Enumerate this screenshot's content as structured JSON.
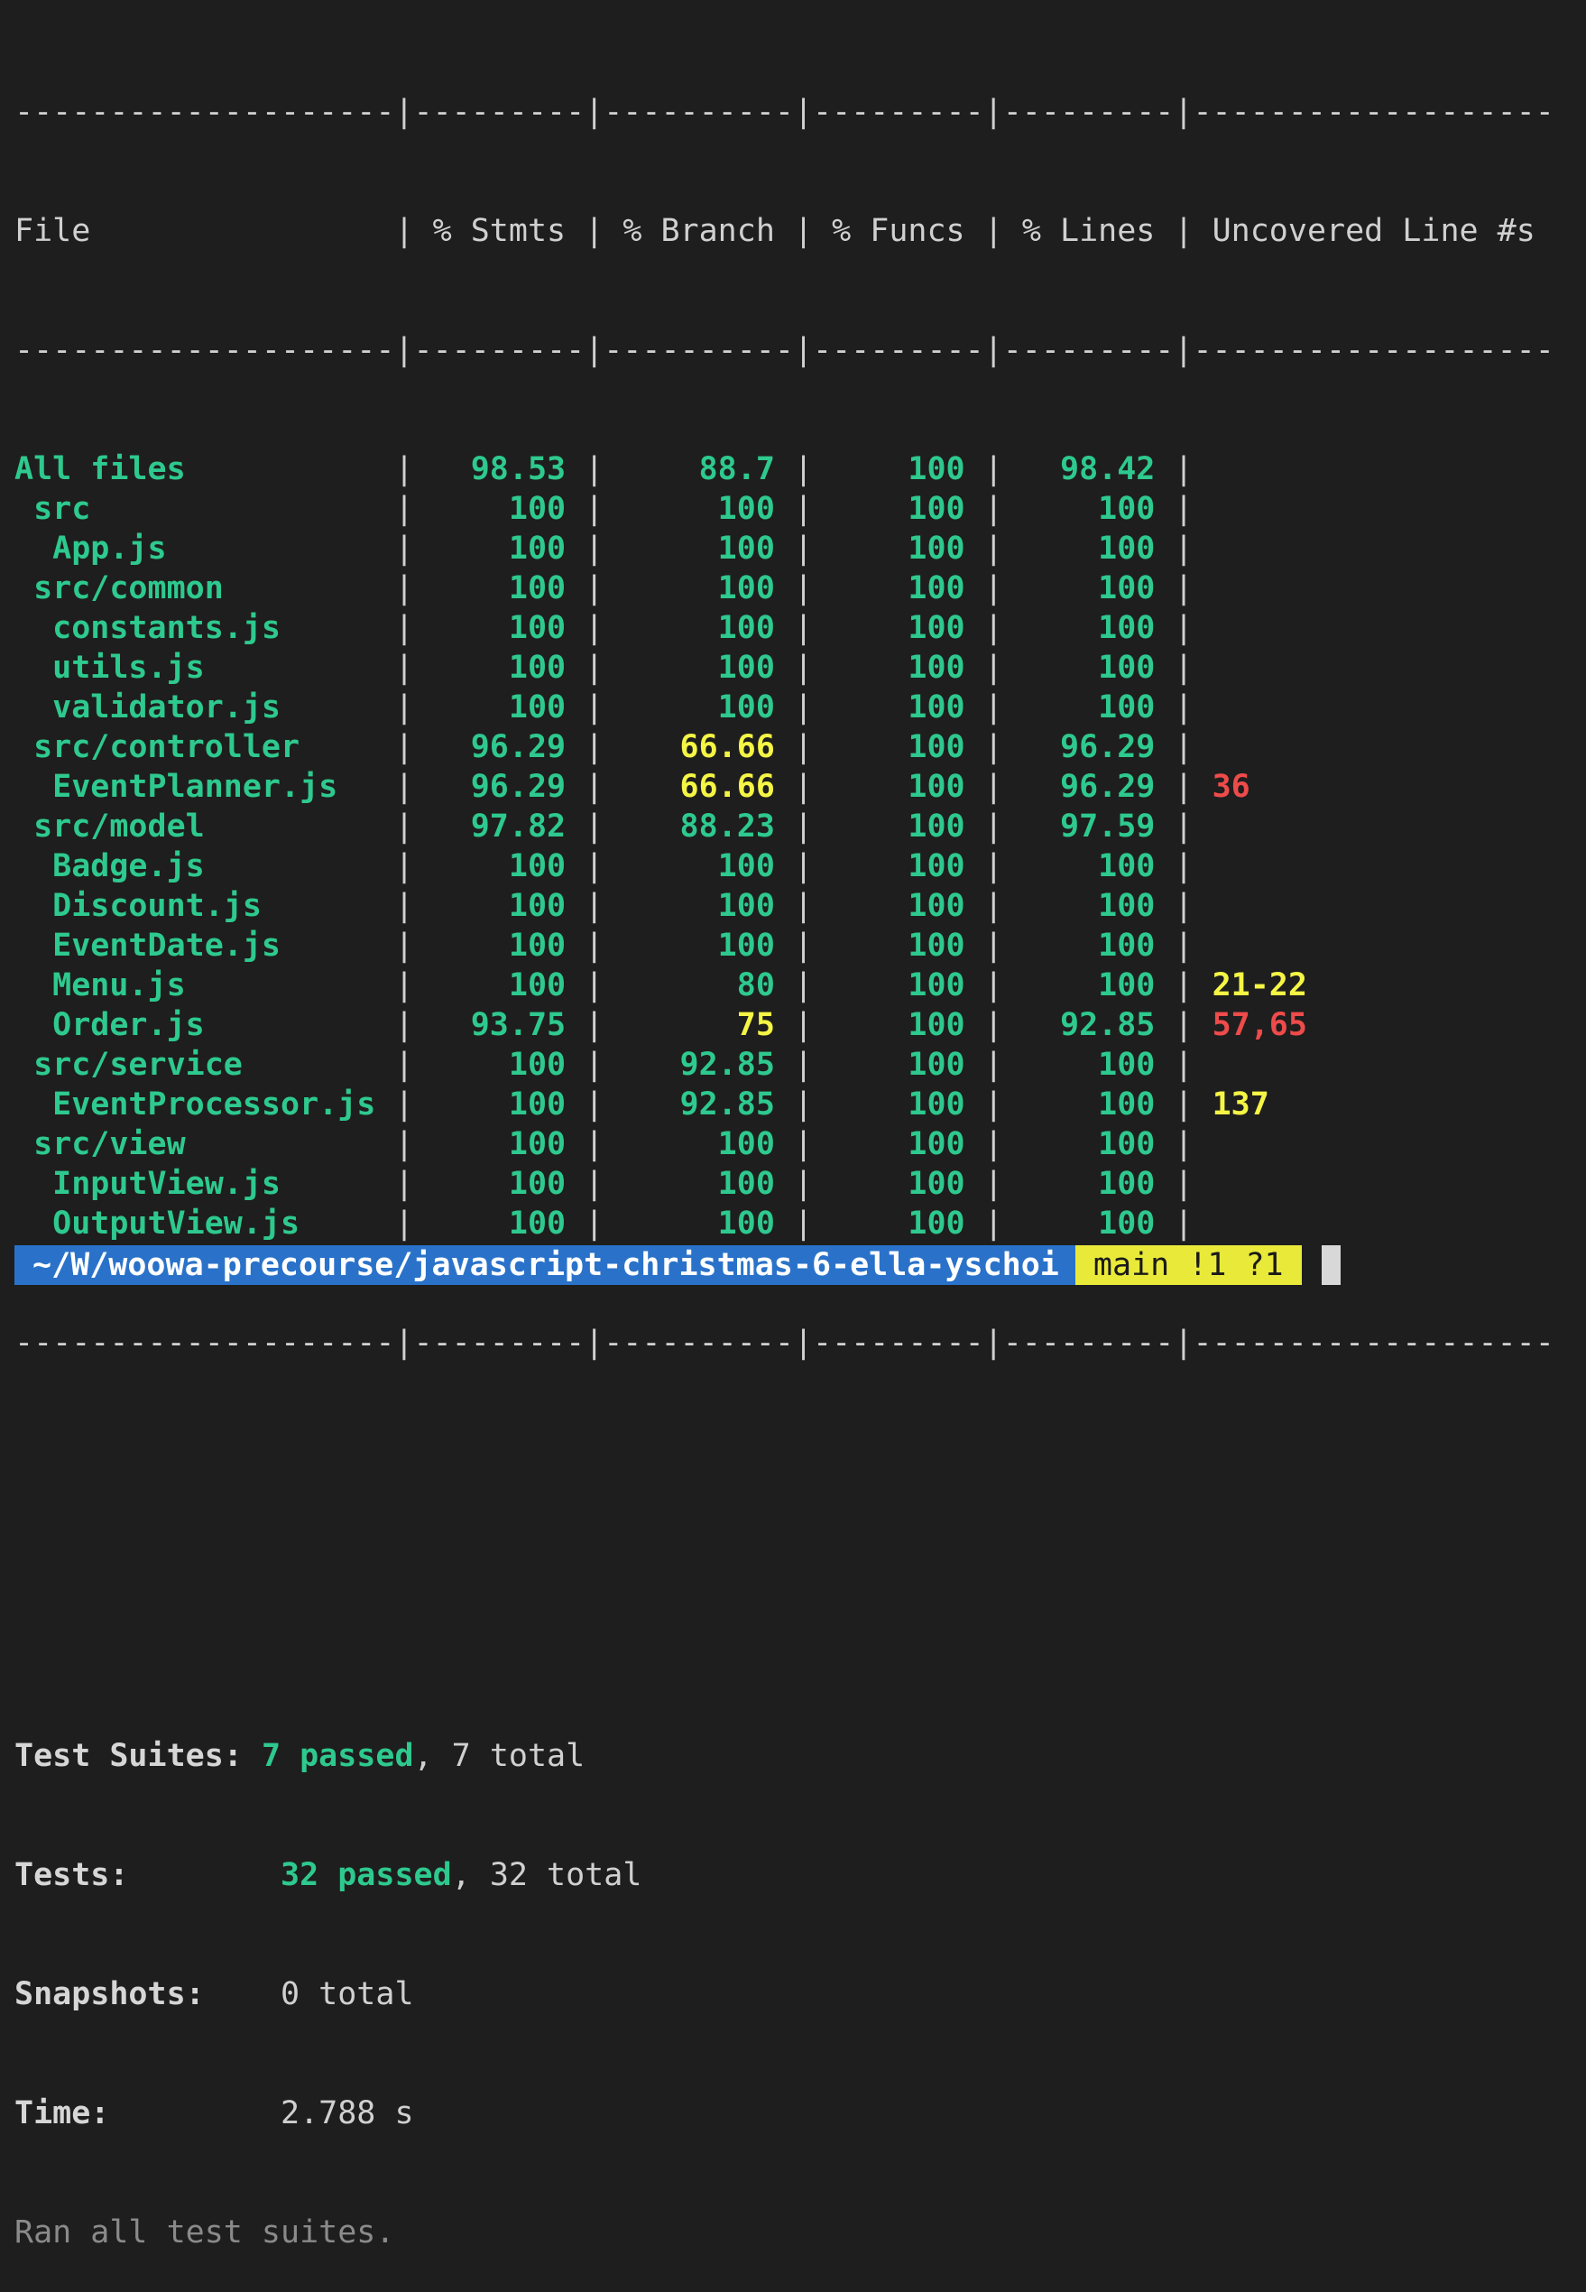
{
  "table": {
    "separator_top": "--------------------|---------|----------|---------|---------|-------------------",
    "separator_mid": "--------------------|---------|----------|---------|---------|-------------------",
    "separator_bottom": "--------------------|---------|----------|---------|---------|-------------------",
    "headers": [
      "File",
      "% Stmts",
      "% Branch",
      "% Funcs",
      "% Lines",
      "Uncovered Line #s"
    ],
    "rows": [
      {
        "file": "All files",
        "stmts": "98.53",
        "branch": "88.7",
        "funcs": "100",
        "lines": "98.42",
        "uncovered": "",
        "branch_color": "green",
        "uncovered_color": ""
      },
      {
        "file": " src",
        "stmts": "100",
        "branch": "100",
        "funcs": "100",
        "lines": "100",
        "uncovered": "",
        "branch_color": "green",
        "uncovered_color": ""
      },
      {
        "file": "  App.js",
        "stmts": "100",
        "branch": "100",
        "funcs": "100",
        "lines": "100",
        "uncovered": "",
        "branch_color": "green",
        "uncovered_color": ""
      },
      {
        "file": " src/common",
        "stmts": "100",
        "branch": "100",
        "funcs": "100",
        "lines": "100",
        "uncovered": "",
        "branch_color": "green",
        "uncovered_color": ""
      },
      {
        "file": "  constants.js",
        "stmts": "100",
        "branch": "100",
        "funcs": "100",
        "lines": "100",
        "uncovered": "",
        "branch_color": "green",
        "uncovered_color": ""
      },
      {
        "file": "  utils.js",
        "stmts": "100",
        "branch": "100",
        "funcs": "100",
        "lines": "100",
        "uncovered": "",
        "branch_color": "green",
        "uncovered_color": ""
      },
      {
        "file": "  validator.js",
        "stmts": "100",
        "branch": "100",
        "funcs": "100",
        "lines": "100",
        "uncovered": "",
        "branch_color": "green",
        "uncovered_color": ""
      },
      {
        "file": " src/controller",
        "stmts": "96.29",
        "branch": "66.66",
        "funcs": "100",
        "lines": "96.29",
        "uncovered": "",
        "branch_color": "yellow",
        "uncovered_color": ""
      },
      {
        "file": "  EventPlanner.js",
        "stmts": "96.29",
        "branch": "66.66",
        "funcs": "100",
        "lines": "96.29",
        "uncovered": "36",
        "branch_color": "yellow",
        "uncovered_color": "red"
      },
      {
        "file": " src/model",
        "stmts": "97.82",
        "branch": "88.23",
        "funcs": "100",
        "lines": "97.59",
        "uncovered": "",
        "branch_color": "green",
        "uncovered_color": ""
      },
      {
        "file": "  Badge.js",
        "stmts": "100",
        "branch": "100",
        "funcs": "100",
        "lines": "100",
        "uncovered": "",
        "branch_color": "green",
        "uncovered_color": ""
      },
      {
        "file": "  Discount.js",
        "stmts": "100",
        "branch": "100",
        "funcs": "100",
        "lines": "100",
        "uncovered": "",
        "branch_color": "green",
        "uncovered_color": ""
      },
      {
        "file": "  EventDate.js",
        "stmts": "100",
        "branch": "100",
        "funcs": "100",
        "lines": "100",
        "uncovered": "",
        "branch_color": "green",
        "uncovered_color": ""
      },
      {
        "file": "  Menu.js",
        "stmts": "100",
        "branch": "80",
        "funcs": "100",
        "lines": "100",
        "uncovered": "21-22",
        "branch_color": "green",
        "uncovered_color": "yellow"
      },
      {
        "file": "  Order.js",
        "stmts": "93.75",
        "branch": "75",
        "funcs": "100",
        "lines": "92.85",
        "uncovered": "57,65",
        "branch_color": "yellow",
        "uncovered_color": "red"
      },
      {
        "file": " src/service",
        "stmts": "100",
        "branch": "92.85",
        "funcs": "100",
        "lines": "100",
        "uncovered": "",
        "branch_color": "green",
        "uncovered_color": ""
      },
      {
        "file": "  EventProcessor.js",
        "stmts": "100",
        "branch": "92.85",
        "funcs": "100",
        "lines": "100",
        "uncovered": "137",
        "branch_color": "green",
        "uncovered_color": "yellow"
      },
      {
        "file": " src/view",
        "stmts": "100",
        "branch": "100",
        "funcs": "100",
        "lines": "100",
        "uncovered": "",
        "branch_color": "green",
        "uncovered_color": ""
      },
      {
        "file": "  InputView.js",
        "stmts": "100",
        "branch": "100",
        "funcs": "100",
        "lines": "100",
        "uncovered": "",
        "branch_color": "green",
        "uncovered_color": ""
      },
      {
        "file": "  OutputView.js",
        "stmts": "100",
        "branch": "100",
        "funcs": "100",
        "lines": "100",
        "uncovered": "",
        "branch_color": "green",
        "uncovered_color": ""
      }
    ]
  },
  "summary": {
    "suites_label": "Test Suites:",
    "suites_passed": "7 passed",
    "suites_total": ", 7 total",
    "tests_label": "Tests:",
    "tests_passed": "32 passed",
    "tests_total": ", 32 total",
    "snapshots_label": "Snapshots:",
    "snapshots_value": "0 total",
    "time_label": "Time:",
    "time_value": "2.788 s",
    "ran_all": "Ran all test suites."
  },
  "prompt": {
    "path": "~/W/woowa-precourse/javascript-christmas-6-ella-yschoi",
    "git": "main !1 ?1"
  },
  "colors": {
    "background": "#1e1e1e",
    "green": "#2ec98e",
    "yellow": "#f5f545",
    "red": "#ee4b4b",
    "prompt_path_bg": "#2a72c9",
    "prompt_git_bg": "#e9e93a"
  }
}
